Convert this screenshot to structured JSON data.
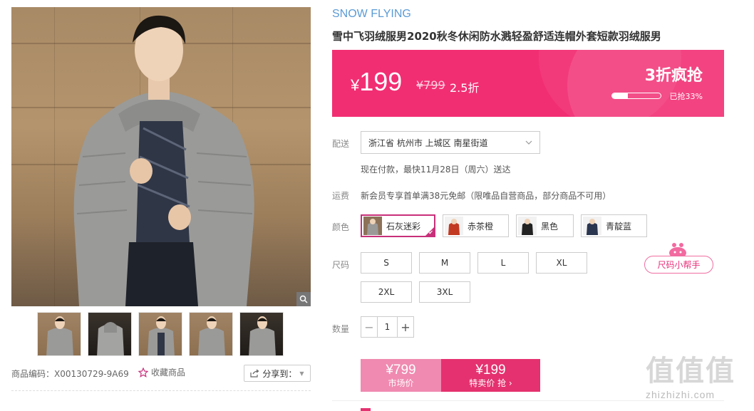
{
  "product": {
    "brand": "SNOW FLYING",
    "title": "雪中飞羽绒服男2020秋冬休闲防水溅轻盈舒适连帽外套短款羽绒服男"
  },
  "price": {
    "current_yen": "¥",
    "current_value": "199",
    "original": "¥799",
    "discount": "2.5折",
    "promo_label": "3折疯抢",
    "sold_text": "已抢33%",
    "sold_fraction": 0.33
  },
  "delivery": {
    "label": "配送",
    "address": "浙江省 杭州市 上城区 南星街道",
    "eta": "现在付款，最快11月28日（周六）送达"
  },
  "freight": {
    "label": "运费",
    "text": "新会员专享首单满38元免邮（限唯品自营商品，部分商品不可用）"
  },
  "colors": {
    "label": "颜色",
    "options": [
      "石灰迷彩",
      "赤茶橙",
      "黑色",
      "青靛蓝"
    ],
    "selected": "石灰迷彩"
  },
  "sizes": {
    "label": "尺码",
    "options": [
      "S",
      "M",
      "L",
      "XL",
      "2XL",
      "3XL"
    ],
    "helper": "尺码小帮手"
  },
  "quantity": {
    "label": "数量",
    "value": "1",
    "minus": "−",
    "plus": "+"
  },
  "buy": {
    "market_price": "¥799",
    "market_label": "市场价",
    "sale_price": "¥199",
    "sale_label": "特卖价 抢 ›"
  },
  "gallery": {
    "sku": "商品编码：X00130729-9A69",
    "favorite": "收藏商品",
    "share": "分享到：",
    "thumb_count": 5
  },
  "watermark": {
    "logo": "值值值",
    "site": "zhizhizhi.com"
  },
  "colors_theme": {
    "accent": "#f22e73",
    "brand_blue": "#5b9bd5",
    "selected_border": "#c8307a"
  }
}
